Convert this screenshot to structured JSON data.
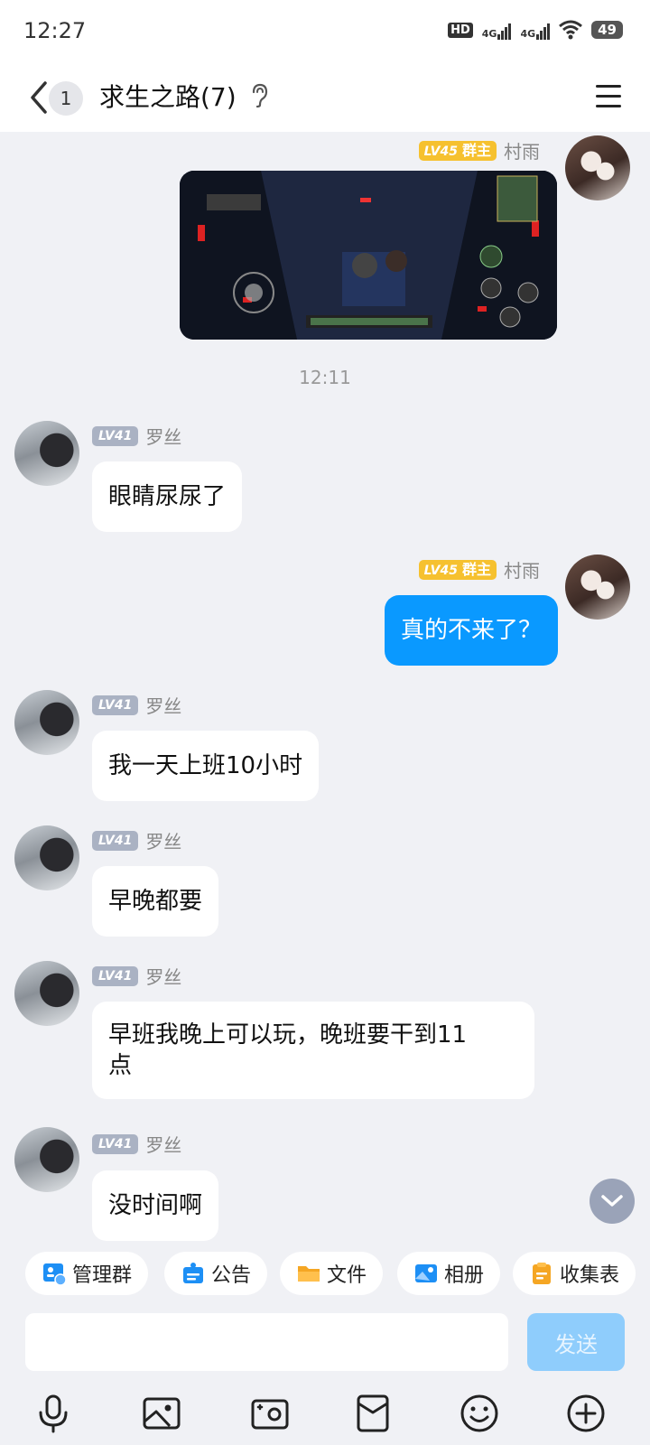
{
  "status_bar": {
    "time": "12:27",
    "hd": "HD",
    "net1": "4G",
    "net2": "4G",
    "battery": "49"
  },
  "header": {
    "unread": "1",
    "title": "求生之路(7)"
  },
  "messages": [
    {
      "sender": "村雨",
      "level": "LV45",
      "role": "群主",
      "self": true,
      "type": "image"
    },
    {
      "sender": "罗丝",
      "level": "LV41",
      "text": "眼睛尿尿了"
    },
    {
      "sender": "村雨",
      "level": "LV45",
      "role": "群主",
      "self": true,
      "text": "真的不来了？"
    },
    {
      "sender": "罗丝",
      "level": "LV41",
      "text": "我一天上班10小时"
    },
    {
      "sender": "罗丝",
      "level": "LV41",
      "text": "早晚都要"
    },
    {
      "sender": "罗丝",
      "level": "LV41",
      "text": "早班我晚上可以玩，晚班要干到11\n点"
    },
    {
      "sender": "罗丝",
      "level": "LV41",
      "text": "没时间啊"
    }
  ],
  "timestamp": "12:11",
  "quick_actions": [
    "管理群",
    "公告",
    "文件",
    "相册",
    "收集表"
  ],
  "input": {
    "placeholder": "",
    "send_label": "发送"
  },
  "colors": {
    "accent": "#0a99ff",
    "owner_badge": "#f6c12f",
    "level_badge": "#aab2c3",
    "background": "#f0f1f5"
  },
  "toolbar_icons": [
    "microphone-icon",
    "image-icon",
    "camera-icon",
    "red-packet-icon",
    "emoji-icon",
    "plus-icon"
  ]
}
